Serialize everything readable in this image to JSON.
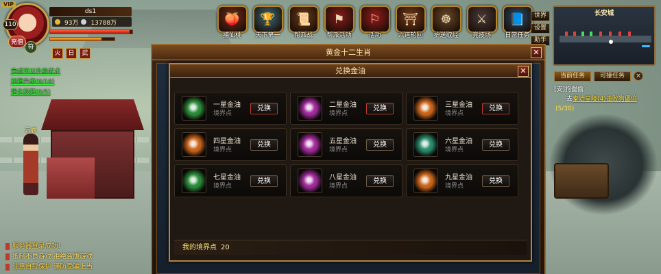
{
  "player": {
    "vip": "VIP",
    "level": "110",
    "name": "ds1",
    "gold": "93万",
    "silver": "13788万",
    "recharge_label": "充值",
    "rune_label": "符",
    "hp_fraction": 0.97,
    "mp_fraction": 0.8,
    "buffs": [
      "火",
      "日",
      "武"
    ]
  },
  "quest_links": [
    "完成可以升级武术",
    "秘籍升级(0/10)",
    "强化秘籍(0/5)"
  ],
  "npc_name": "云衣",
  "chat": [
    "服务器登录成功！",
    "抵制不良游戏 拒绝盗版游戏",
    "注意自我保护 谨防受骗上当"
  ],
  "top_menu": [
    {
      "label": "捕仙桃",
      "icon": "peach-icon",
      "color": "#7a2a1a"
    },
    {
      "label": "天下第一",
      "icon": "trophy-icon",
      "color": "#3a6a7a"
    },
    {
      "label": "帮派战",
      "icon": "scroll-icon",
      "color": "#6a3a1a"
    },
    {
      "label": "帮派活动",
      "icon": "flag-icon",
      "color": "#8a1a1a"
    },
    {
      "label": "活动",
      "icon": "banner-icon",
      "color": "#9a1a1a"
    },
    {
      "label": "六道轮回",
      "icon": "pagoda-icon",
      "color": "#7a3a1a"
    },
    {
      "label": "护送取经",
      "icon": "monk-icon",
      "color": "#6a4a2a"
    },
    {
      "label": "竞技场",
      "icon": "sword-icon",
      "color": "#4a3a3a"
    },
    {
      "label": "日常任务",
      "icon": "book-icon",
      "color": "#2a4a6a"
    }
  ],
  "side_buttons": [
    "世界",
    "设置",
    "助手"
  ],
  "minimap": {
    "title": "长安城"
  },
  "quest_panel": {
    "tabs": [
      "当前任务",
      "可接任务"
    ],
    "close": "×",
    "line1": "[支]狗儡偷",
    "line2_prefix": "去",
    "line2_link": "秦始皇陵(4)击败狗儡偷",
    "line3": "(5/30)"
  },
  "outer_panel": {
    "title": "黄金十二生肖",
    "close": "✕"
  },
  "dialog": {
    "title": "兑换金油",
    "close": "✕",
    "items": [
      {
        "name": "一星金油",
        "sub": "境界点",
        "button": "兑换",
        "color": "#2a8a3a"
      },
      {
        "name": "二星金油",
        "sub": "境界点",
        "button": "兑换",
        "color": "#a02a9a"
      },
      {
        "name": "三星金油",
        "sub": "境界点",
        "button": "兑换",
        "color": "#c8641a"
      },
      {
        "name": "四星金油",
        "sub": "境界点",
        "button": "兑换",
        "color": "#c8641a"
      },
      {
        "name": "五星金油",
        "sub": "境界点",
        "button": "兑换",
        "color": "#a02a9a"
      },
      {
        "name": "六星金油",
        "sub": "境界点",
        "button": "兑换",
        "color": "#2a8a6a"
      },
      {
        "name": "七星金油",
        "sub": "境界点",
        "button": "兑换",
        "color": "#2a8a3a"
      },
      {
        "name": "八星金油",
        "sub": "境界点",
        "button": "兑换",
        "color": "#a02a9a"
      },
      {
        "name": "九星金油",
        "sub": "境界点",
        "button": "兑换",
        "color": "#c8641a"
      }
    ],
    "footer_label": "我的境界点",
    "footer_value": "20"
  }
}
